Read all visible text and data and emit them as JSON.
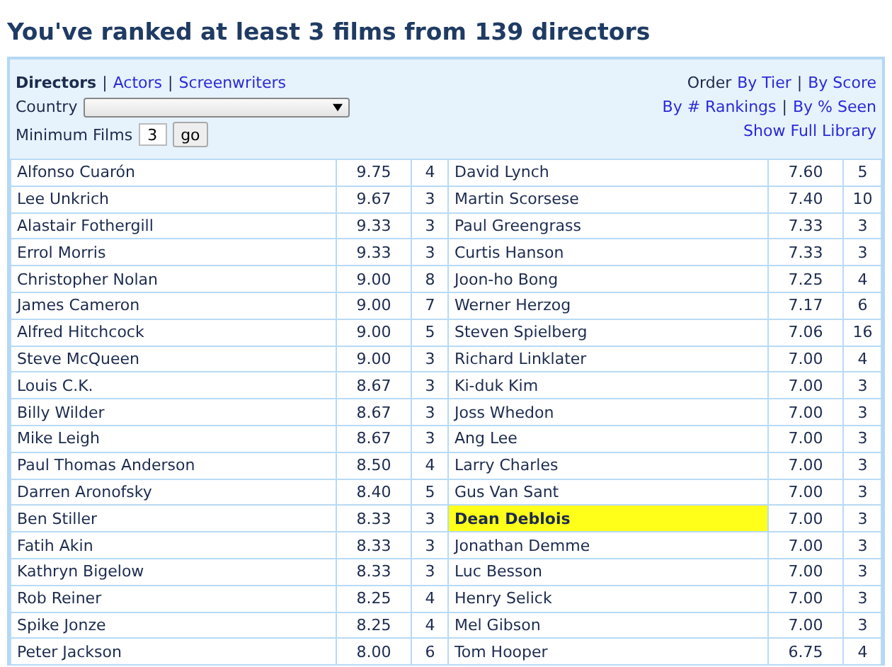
{
  "title": "You've ranked at least 3 films from 139 directors",
  "separator": "|",
  "categories": [
    {
      "label": "Directors",
      "selected": true
    },
    {
      "label": "Actors",
      "selected": false
    },
    {
      "label": "Screenwriters",
      "selected": false
    }
  ],
  "country": {
    "label": "Country"
  },
  "minimum_films": {
    "label": "Minimum Films",
    "value": "3",
    "button": "go"
  },
  "order": {
    "label": "Order",
    "links": [
      "By Tier",
      "By Score"
    ]
  },
  "order_links_2": [
    "By # Rankings",
    "By % Seen"
  ],
  "library_link": "Show Full Library",
  "left_column": [
    {
      "name": "Alfonso Cuarón",
      "score": "9.75",
      "films": "4",
      "highlighted": false
    },
    {
      "name": "Lee Unkrich",
      "score": "9.67",
      "films": "3",
      "highlighted": false
    },
    {
      "name": "Alastair Fothergill",
      "score": "9.33",
      "films": "3",
      "highlighted": false
    },
    {
      "name": "Errol Morris",
      "score": "9.33",
      "films": "3",
      "highlighted": false
    },
    {
      "name": "Christopher Nolan",
      "score": "9.00",
      "films": "8",
      "highlighted": false
    },
    {
      "name": "James Cameron",
      "score": "9.00",
      "films": "7",
      "highlighted": false
    },
    {
      "name": "Alfred Hitchcock",
      "score": "9.00",
      "films": "5",
      "highlighted": false
    },
    {
      "name": "Steve McQueen",
      "score": "9.00",
      "films": "3",
      "highlighted": false
    },
    {
      "name": "Louis C.K.",
      "score": "8.67",
      "films": "3",
      "highlighted": false
    },
    {
      "name": "Billy Wilder",
      "score": "8.67",
      "films": "3",
      "highlighted": false
    },
    {
      "name": "Mike Leigh",
      "score": "8.67",
      "films": "3",
      "highlighted": false
    },
    {
      "name": "Paul Thomas Anderson",
      "score": "8.50",
      "films": "4",
      "highlighted": false
    },
    {
      "name": "Darren Aronofsky",
      "score": "8.40",
      "films": "5",
      "highlighted": false
    },
    {
      "name": "Ben Stiller",
      "score": "8.33",
      "films": "3",
      "highlighted": false
    },
    {
      "name": "Fatih Akin",
      "score": "8.33",
      "films": "3",
      "highlighted": false
    },
    {
      "name": "Kathryn Bigelow",
      "score": "8.33",
      "films": "3",
      "highlighted": false
    },
    {
      "name": "Rob Reiner",
      "score": "8.25",
      "films": "4",
      "highlighted": false
    },
    {
      "name": "Spike Jonze",
      "score": "8.25",
      "films": "4",
      "highlighted": false
    },
    {
      "name": "Peter Jackson",
      "score": "8.00",
      "films": "6",
      "highlighted": false
    }
  ],
  "right_column": [
    {
      "name": "David Lynch",
      "score": "7.60",
      "films": "5",
      "highlighted": false
    },
    {
      "name": "Martin Scorsese",
      "score": "7.40",
      "films": "10",
      "highlighted": false
    },
    {
      "name": "Paul Greengrass",
      "score": "7.33",
      "films": "3",
      "highlighted": false
    },
    {
      "name": "Curtis Hanson",
      "score": "7.33",
      "films": "3",
      "highlighted": false
    },
    {
      "name": "Joon-ho Bong",
      "score": "7.25",
      "films": "4",
      "highlighted": false
    },
    {
      "name": "Werner Herzog",
      "score": "7.17",
      "films": "6",
      "highlighted": false
    },
    {
      "name": "Steven Spielberg",
      "score": "7.06",
      "films": "16",
      "highlighted": false
    },
    {
      "name": "Richard Linklater",
      "score": "7.00",
      "films": "4",
      "highlighted": false
    },
    {
      "name": "Ki-duk Kim",
      "score": "7.00",
      "films": "3",
      "highlighted": false
    },
    {
      "name": "Joss Whedon",
      "score": "7.00",
      "films": "3",
      "highlighted": false
    },
    {
      "name": "Ang Lee",
      "score": "7.00",
      "films": "3",
      "highlighted": false
    },
    {
      "name": "Larry Charles",
      "score": "7.00",
      "films": "3",
      "highlighted": false
    },
    {
      "name": "Gus Van Sant",
      "score": "7.00",
      "films": "3",
      "highlighted": false
    },
    {
      "name": "Dean Deblois",
      "score": "7.00",
      "films": "3",
      "highlighted": true
    },
    {
      "name": "Jonathan Demme",
      "score": "7.00",
      "films": "3",
      "highlighted": false
    },
    {
      "name": "Luc Besson",
      "score": "7.00",
      "films": "3",
      "highlighted": false
    },
    {
      "name": "Henry Selick",
      "score": "7.00",
      "films": "3",
      "highlighted": false
    },
    {
      "name": "Mel Gibson",
      "score": "7.00",
      "films": "3",
      "highlighted": false
    },
    {
      "name": "Tom Hooper",
      "score": "6.75",
      "films": "4",
      "highlighted": false
    }
  ]
}
